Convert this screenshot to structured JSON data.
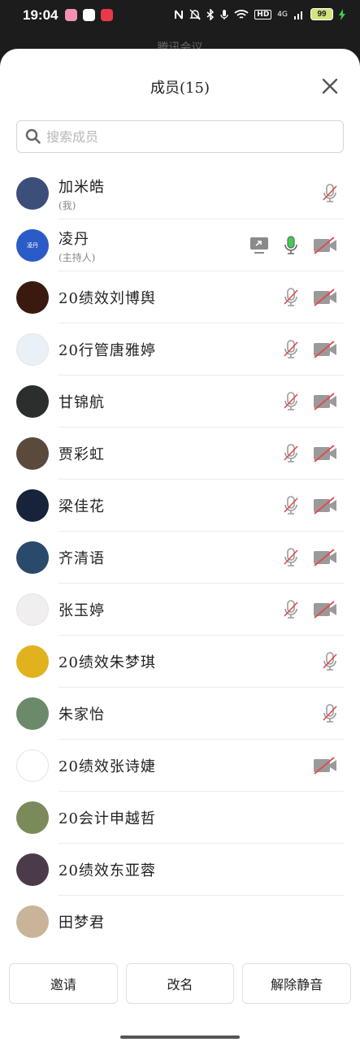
{
  "status_bar": {
    "time": "19:04",
    "battery": "99",
    "network": "4G",
    "hd": "HD",
    "app_dot_colors": [
      "#f58fb4",
      "#ffffff",
      "#e8394a"
    ]
  },
  "behind": {
    "title": "腾讯会议"
  },
  "sheet": {
    "title": "成员(15)",
    "search_placeholder": "搜索成员"
  },
  "members": [
    {
      "name": "加米皓",
      "sub": "(我)",
      "avatar_color": "#3b4f7a",
      "avatar_label": "",
      "screen": false,
      "mic": "muted",
      "cam": "none"
    },
    {
      "name": "凌丹",
      "sub": "(主持人)",
      "avatar_color": "#2b5bc6",
      "avatar_label": "凌丹",
      "screen": true,
      "mic": "active",
      "cam": "off"
    },
    {
      "name": "20绩效刘博舆",
      "sub": "",
      "avatar_color": "#3a1a0f",
      "avatar_label": "",
      "screen": false,
      "mic": "off",
      "cam": "off"
    },
    {
      "name": "20行管唐雅婷",
      "sub": "",
      "avatar_color": "#e9f1f7",
      "avatar_label": "",
      "screen": false,
      "mic": "off",
      "cam": "off"
    },
    {
      "name": "甘锦航",
      "sub": "",
      "avatar_color": "#2a2e2c",
      "avatar_label": "",
      "screen": false,
      "mic": "off",
      "cam": "off"
    },
    {
      "name": "贾彩虹",
      "sub": "",
      "avatar_color": "#5a4a3c",
      "avatar_label": "",
      "screen": false,
      "mic": "off",
      "cam": "off"
    },
    {
      "name": "梁佳花",
      "sub": "",
      "avatar_color": "#17223b",
      "avatar_label": "",
      "screen": false,
      "mic": "off",
      "cam": "off"
    },
    {
      "name": "齐清语",
      "sub": "",
      "avatar_color": "#2a4a6b",
      "avatar_label": "",
      "screen": false,
      "mic": "off",
      "cam": "off"
    },
    {
      "name": "张玉婷",
      "sub": "",
      "avatar_color": "#f1eef0",
      "avatar_label": "",
      "screen": false,
      "mic": "off",
      "cam": "off"
    },
    {
      "name": "20绩效朱梦琪",
      "sub": "",
      "avatar_color": "#e0b21d",
      "avatar_label": "",
      "screen": false,
      "mic": "muted",
      "cam": "none"
    },
    {
      "name": "朱家怡",
      "sub": "",
      "avatar_color": "#6b8a6a",
      "avatar_label": "",
      "screen": false,
      "mic": "muted",
      "cam": "none"
    },
    {
      "name": "20绩效张诗婕",
      "sub": "",
      "avatar_color": "#ffffff",
      "avatar_label": "",
      "screen": false,
      "mic": "none",
      "cam": "off"
    },
    {
      "name": "20会计申越哲",
      "sub": "",
      "avatar_color": "#7a8a5a",
      "avatar_label": "",
      "screen": false,
      "mic": "none",
      "cam": "none"
    },
    {
      "name": "20绩效东亚蓉",
      "sub": "",
      "avatar_color": "#4a3a4a",
      "avatar_label": "",
      "screen": false,
      "mic": "none",
      "cam": "none"
    },
    {
      "name": "田梦君",
      "sub": "",
      "avatar_color": "#c9b49a",
      "avatar_label": "",
      "screen": false,
      "mic": "none",
      "cam": "none"
    }
  ],
  "buttons": {
    "invite": "邀请",
    "rename": "改名",
    "unmute": "解除静音"
  },
  "colors": {
    "muted_red": "#e5484d",
    "icon_gray": "#9a9a9a",
    "mic_active_green": "#3ccf4e"
  }
}
